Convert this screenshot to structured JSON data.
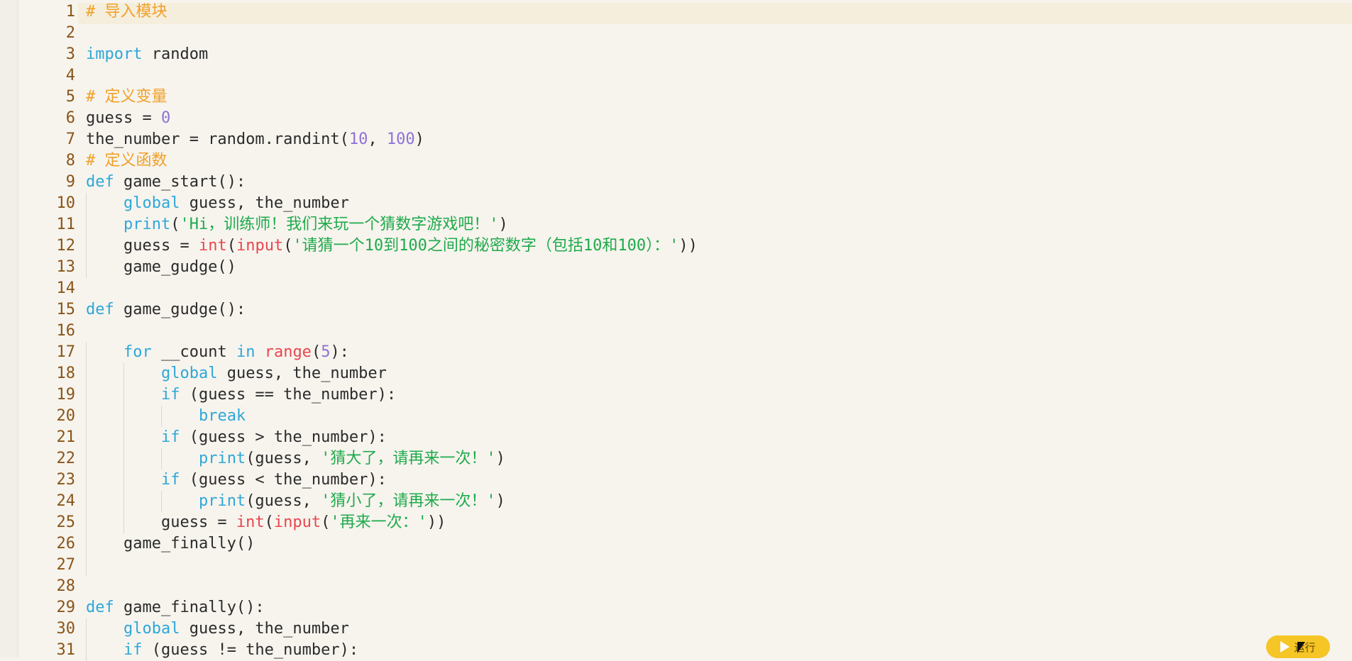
{
  "editor": {
    "line_numbers": [
      "1",
      "2",
      "3",
      "4",
      "5",
      "6",
      "7",
      "8",
      "9",
      "10",
      "11",
      "12",
      "13",
      "14",
      "15",
      "16",
      "17",
      "18",
      "19",
      "20",
      "21",
      "22",
      "23",
      "24",
      "25",
      "26",
      "27",
      "28",
      "29",
      "30",
      "31"
    ],
    "lines": [
      [
        {
          "t": "# 导入模块",
          "c": "comment"
        }
      ],
      [],
      [
        {
          "t": "import",
          "c": "keyword"
        },
        {
          "t": " random",
          "c": "plain"
        }
      ],
      [],
      [
        {
          "t": "# 定义变量",
          "c": "comment"
        }
      ],
      [
        {
          "t": "guess = ",
          "c": "plain"
        },
        {
          "t": "0",
          "c": "number"
        }
      ],
      [
        {
          "t": "the_number = random.randint(",
          "c": "plain"
        },
        {
          "t": "10",
          "c": "number"
        },
        {
          "t": ", ",
          "c": "plain"
        },
        {
          "t": "100",
          "c": "number"
        },
        {
          "t": ")",
          "c": "plain"
        }
      ],
      [
        {
          "t": "# 定义函数",
          "c": "comment"
        }
      ],
      [
        {
          "t": "def",
          "c": "keyword"
        },
        {
          "t": " game_start():",
          "c": "plain"
        }
      ],
      [
        {
          "t": "    ",
          "c": "plain"
        },
        {
          "t": "global",
          "c": "keyword"
        },
        {
          "t": " guess, the_number",
          "c": "plain"
        }
      ],
      [
        {
          "t": "    ",
          "c": "plain"
        },
        {
          "t": "print",
          "c": "builtin2"
        },
        {
          "t": "(",
          "c": "plain"
        },
        {
          "t": "'Hi，训练师！我们来玩一个猜数字游戏吧！'",
          "c": "string"
        },
        {
          "t": ")",
          "c": "plain"
        }
      ],
      [
        {
          "t": "    guess = ",
          "c": "plain"
        },
        {
          "t": "int",
          "c": "builtin"
        },
        {
          "t": "(",
          "c": "plain"
        },
        {
          "t": "input",
          "c": "builtin"
        },
        {
          "t": "(",
          "c": "plain"
        },
        {
          "t": "'请猜一个10到100之间的秘密数字（包括10和100）：'",
          "c": "string"
        },
        {
          "t": "))",
          "c": "plain"
        }
      ],
      [
        {
          "t": "    game_gudge()",
          "c": "plain"
        }
      ],
      [],
      [
        {
          "t": "def",
          "c": "keyword"
        },
        {
          "t": " game_gudge():",
          "c": "plain"
        }
      ],
      [],
      [
        {
          "t": "    ",
          "c": "plain"
        },
        {
          "t": "for",
          "c": "keyword"
        },
        {
          "t": " __count ",
          "c": "plain"
        },
        {
          "t": "in",
          "c": "keyword"
        },
        {
          "t": " ",
          "c": "plain"
        },
        {
          "t": "range",
          "c": "builtin"
        },
        {
          "t": "(",
          "c": "plain"
        },
        {
          "t": "5",
          "c": "number"
        },
        {
          "t": "):",
          "c": "plain"
        }
      ],
      [
        {
          "t": "        ",
          "c": "plain"
        },
        {
          "t": "global",
          "c": "keyword"
        },
        {
          "t": " guess, the_number",
          "c": "plain"
        }
      ],
      [
        {
          "t": "        ",
          "c": "plain"
        },
        {
          "t": "if",
          "c": "keyword"
        },
        {
          "t": " (guess == the_number):",
          "c": "plain"
        }
      ],
      [
        {
          "t": "            ",
          "c": "plain"
        },
        {
          "t": "break",
          "c": "keyword"
        }
      ],
      [
        {
          "t": "        ",
          "c": "plain"
        },
        {
          "t": "if",
          "c": "keyword"
        },
        {
          "t": " (guess > the_number):",
          "c": "plain"
        }
      ],
      [
        {
          "t": "            ",
          "c": "plain"
        },
        {
          "t": "print",
          "c": "builtin2"
        },
        {
          "t": "(guess, ",
          "c": "plain"
        },
        {
          "t": "'猜大了，请再来一次！'",
          "c": "string"
        },
        {
          "t": ")",
          "c": "plain"
        }
      ],
      [
        {
          "t": "        ",
          "c": "plain"
        },
        {
          "t": "if",
          "c": "keyword"
        },
        {
          "t": " (guess < the_number):",
          "c": "plain"
        }
      ],
      [
        {
          "t": "            ",
          "c": "plain"
        },
        {
          "t": "print",
          "c": "builtin2"
        },
        {
          "t": "(guess, ",
          "c": "plain"
        },
        {
          "t": "'猜小了，请再来一次！'",
          "c": "string"
        },
        {
          "t": ")",
          "c": "plain"
        }
      ],
      [
        {
          "t": "        guess = ",
          "c": "plain"
        },
        {
          "t": "int",
          "c": "builtin"
        },
        {
          "t": "(",
          "c": "plain"
        },
        {
          "t": "input",
          "c": "builtin"
        },
        {
          "t": "(",
          "c": "plain"
        },
        {
          "t": "'再来一次：'",
          "c": "string"
        },
        {
          "t": "))",
          "c": "plain"
        }
      ],
      [
        {
          "t": "    game_finally()",
          "c": "plain"
        }
      ],
      [],
      [],
      [
        {
          "t": "def",
          "c": "keyword"
        },
        {
          "t": " game_finally():",
          "c": "plain"
        }
      ],
      [
        {
          "t": "    ",
          "c": "plain"
        },
        {
          "t": "global",
          "c": "keyword"
        },
        {
          "t": " guess, the_number",
          "c": "plain"
        }
      ],
      [
        {
          "t": "    ",
          "c": "plain"
        },
        {
          "t": "if",
          "c": "keyword"
        },
        {
          "t": " (guess != the_number):",
          "c": "plain"
        }
      ]
    ]
  },
  "run_button": {
    "label": "运行",
    "icon": "play-icon"
  }
}
